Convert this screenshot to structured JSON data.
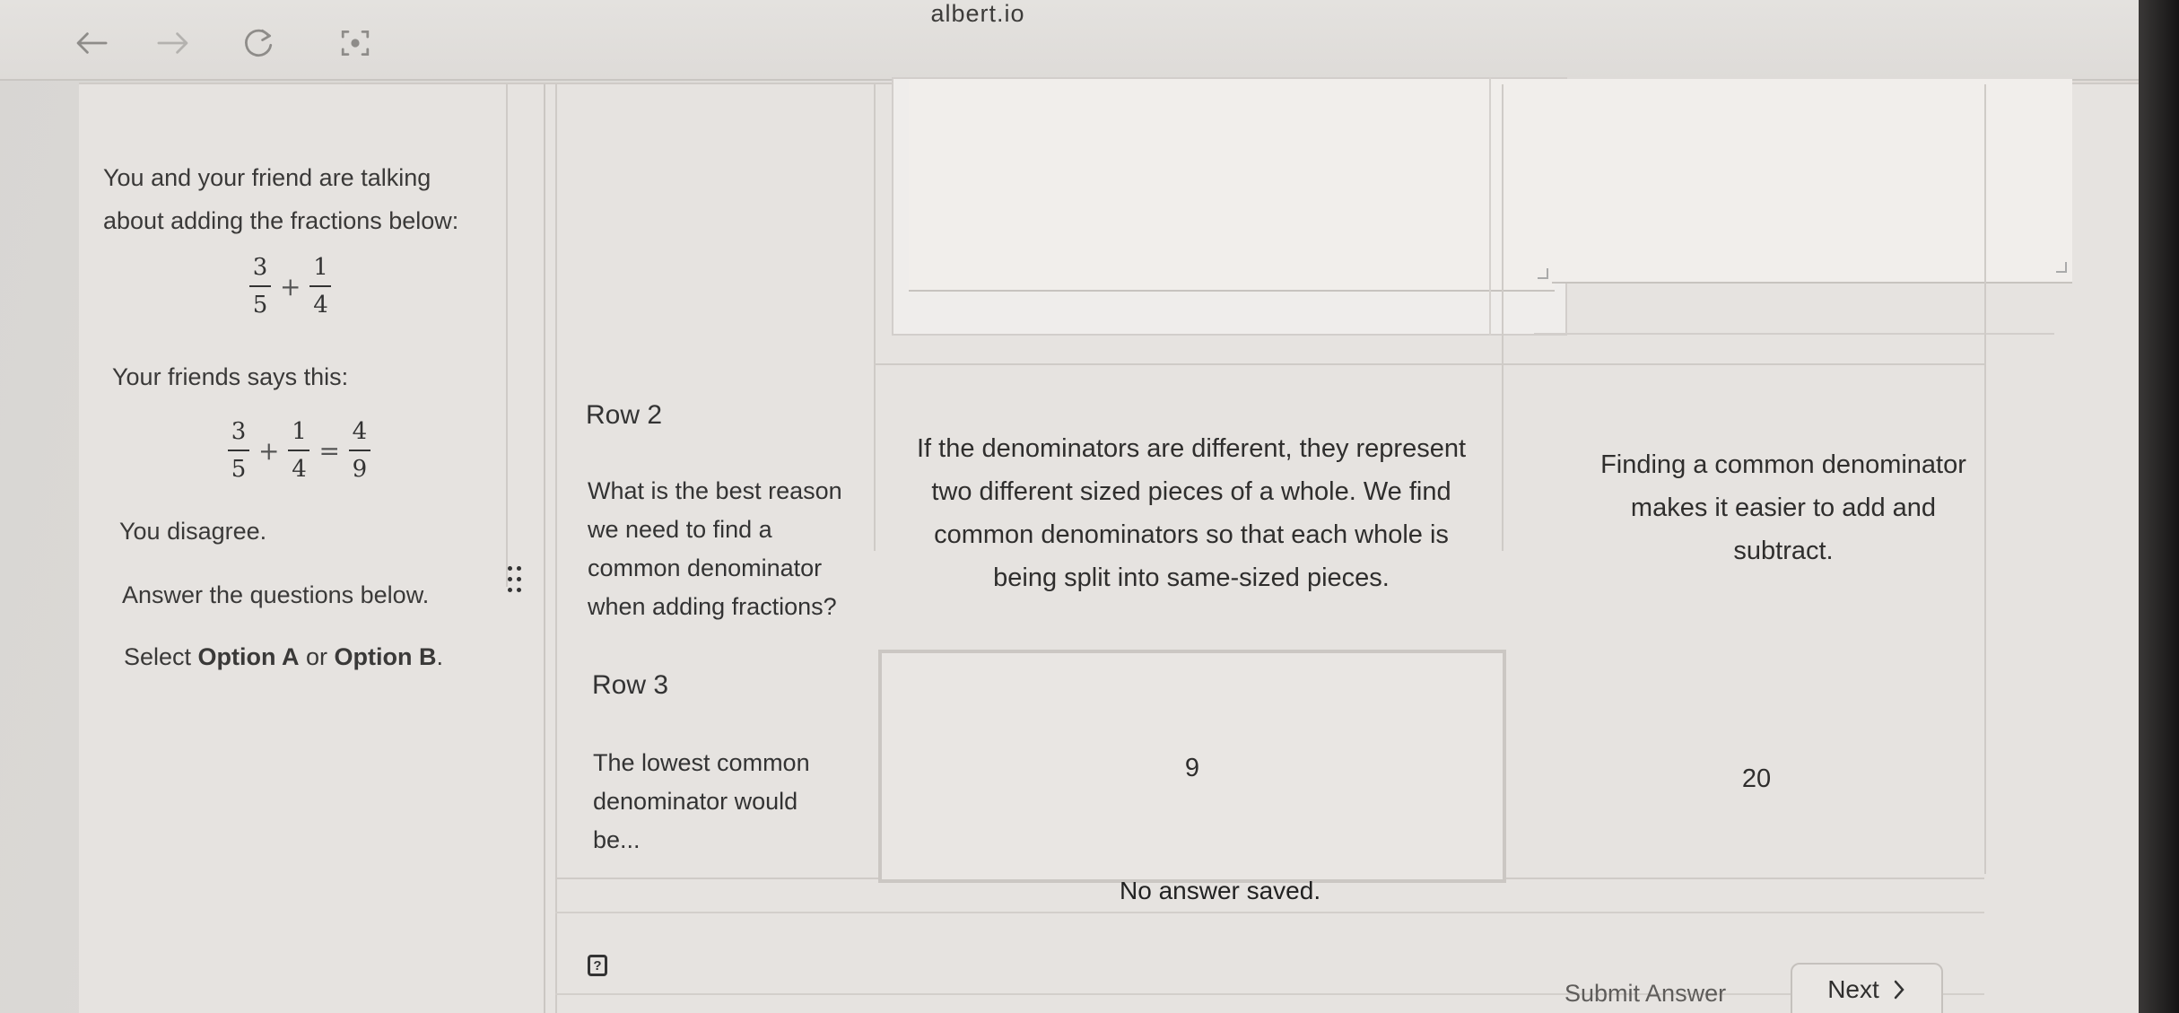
{
  "browser": {
    "url": "albert.io",
    "icons": [
      "back-arrow-icon",
      "forward-arrow-icon",
      "reload-icon",
      "screen-capture-icon"
    ]
  },
  "problem": {
    "intro_line1": "You and your friend are talking",
    "intro_line2": "about adding the fractions below:",
    "expr1": {
      "a_num": "3",
      "a_den": "5",
      "op": "+",
      "b_num": "1",
      "b_den": "4"
    },
    "friend_says": "Your friends says this:",
    "expr2": {
      "a_num": "3",
      "a_den": "5",
      "op": "+",
      "b_num": "1",
      "b_den": "4",
      "eq": "=",
      "c_num": "4",
      "c_den": "9"
    },
    "disagree": "You disagree.",
    "answer_below": "Answer the questions below.",
    "select_prefix": "Select ",
    "option_a": "Option A",
    "select_or": " or ",
    "option_b": "Option B",
    "select_suffix": "."
  },
  "rows": [
    {
      "label": "Row 2",
      "question_lines": [
        "What is the best reason",
        "we need to find a",
        "common denominator",
        "when adding fractions?"
      ],
      "option_a_lines": [
        "If the denominators are different, they represent",
        "two different sized pieces of a whole. We find",
        "common denominators so that each whole is",
        "being split into same-sized pieces."
      ],
      "option_b_lines": [
        "Finding a common denominator",
        "makes it easier to add and",
        "subtract."
      ]
    },
    {
      "label": "Row 3",
      "question_lines": [
        "The lowest common",
        "denominator would",
        "be..."
      ],
      "option_a": "9",
      "option_b": "20"
    }
  ],
  "footer": {
    "status": "No answer saved.",
    "help": "?",
    "submit_label": "Submit Answer",
    "next_label": "Next",
    "next_icon": "chevron-right-icon"
  }
}
